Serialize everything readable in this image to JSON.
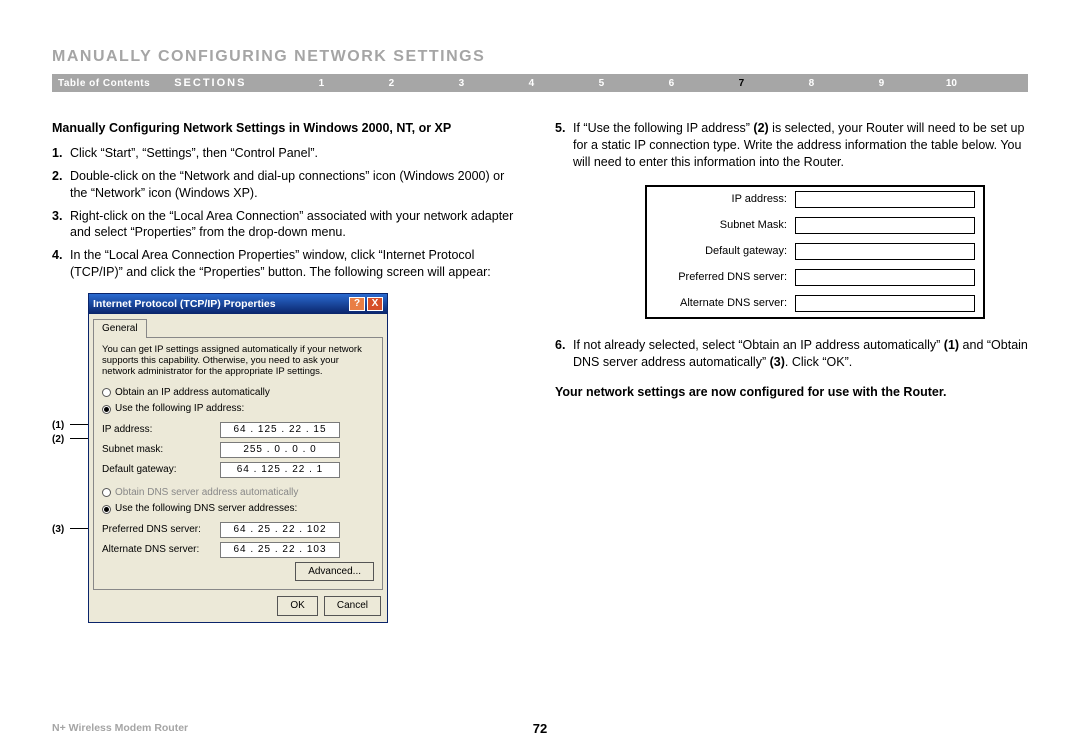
{
  "page_title": "MANUALLY CONFIGURING NETWORK SETTINGS",
  "nav": {
    "toc": "Table of Contents",
    "sections": "SECTIONS",
    "items": [
      "1",
      "2",
      "3",
      "4",
      "5",
      "6",
      "7",
      "8",
      "9",
      "10"
    ],
    "active": "7"
  },
  "left": {
    "subhead": "Manually Configuring Network Settings in Windows 2000, NT, or XP",
    "steps": [
      {
        "n": "1.",
        "t": "Click “Start”, “Settings”, then “Control Panel”."
      },
      {
        "n": "2.",
        "t": "Double-click on the “Network and dial-up connections” icon (Windows 2000) or the “Network” icon (Windows XP)."
      },
      {
        "n": "3.",
        "t": "Right-click on the “Local Area Connection” associated with your network adapter and select “Properties” from the drop-down menu."
      },
      {
        "n": "4.",
        "t": "In the “Local Area Connection Properties” window, click “Internet Protocol (TCP/IP)” and click the “Properties” button. The following screen will appear:"
      }
    ],
    "callouts": {
      "c1": "(1)",
      "c2": "(2)",
      "c3": "(3)"
    }
  },
  "dialog": {
    "title": "Internet Protocol (TCP/IP) Properties",
    "tab": "General",
    "desc": "You can get IP settings assigned automatically if your network supports this capability. Otherwise, you need to ask your network administrator for the appropriate IP settings.",
    "r_auto_ip": "Obtain an IP address automatically",
    "r_use_ip": "Use the following IP address:",
    "ip_label": "IP address:",
    "ip_val": "64 . 125 . 22 . 15",
    "mask_label": "Subnet mask:",
    "mask_val": "255 . 0 . 0 . 0",
    "gw_label": "Default gateway:",
    "gw_val": "64 . 125 . 22 . 1",
    "r_auto_dns": "Obtain DNS server address automatically",
    "r_use_dns": "Use the following DNS server addresses:",
    "pdns_label": "Preferred DNS server:",
    "pdns_val": "64 . 25 . 22 . 102",
    "adns_label": "Alternate DNS server:",
    "adns_val": "64 . 25 . 22 . 103",
    "advanced": "Advanced...",
    "ok": "OK",
    "cancel": "Cancel"
  },
  "right": {
    "step5_pre": "If “Use the following IP address” ",
    "step5_bold": "(2)",
    "step5_post": " is selected, your Router will need to be set up for a static IP connection type. Write the address information the table below. You will need to enter this information into the Router.",
    "table": {
      "ip": "IP address:",
      "mask": "Subnet Mask:",
      "gw": "Default gateway:",
      "pdns": "Preferred DNS server:",
      "adns": "Alternate DNS server:"
    },
    "step6_a": "If not already selected, select “Obtain an IP address automatically” ",
    "step6_b1": "(1)",
    "step6_b": " and “Obtain DNS server address automatically” ",
    "step6_b3": "(3)",
    "step6_c": ". Click “OK”.",
    "final": "Your network settings are now configured for use with the Router."
  },
  "footer": {
    "product": "N+ Wireless Modem Router",
    "page": "72"
  }
}
